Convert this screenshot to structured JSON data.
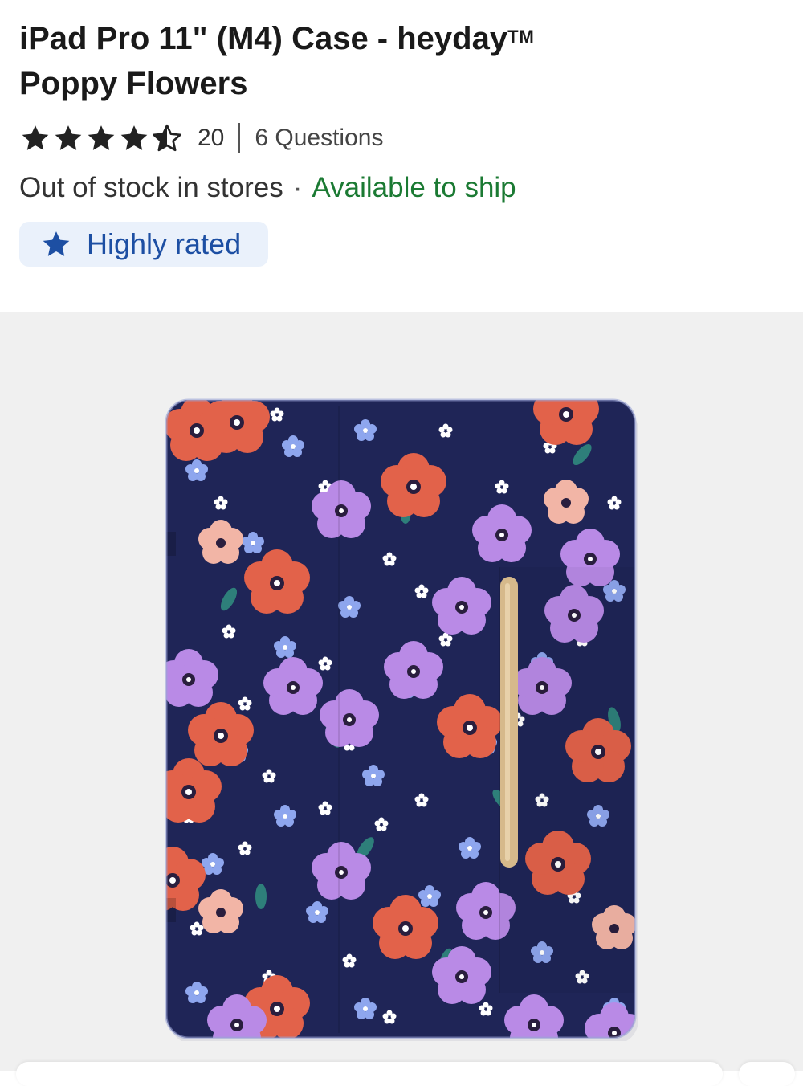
{
  "product": {
    "title_main": "iPad Pro 11\" (M4) Case - heyday",
    "title_tm": "TM",
    "title_line2": "Poppy Flowers"
  },
  "rating": {
    "stars": 4.5,
    "review_count": "20",
    "questions": "6 Questions",
    "star_color": "#222222"
  },
  "availability": {
    "store_status": "Out of stock in stores",
    "separator": "·",
    "ship_status": "Available to ship",
    "ship_color": "#1b7a33"
  },
  "badge": {
    "icon": "star-icon",
    "label": "Highly rated",
    "color": "#1d4fa3",
    "background": "#eaf1fb"
  },
  "gallery": {
    "image_alt": "Floral iPad case",
    "background": "#f0f0f0"
  }
}
